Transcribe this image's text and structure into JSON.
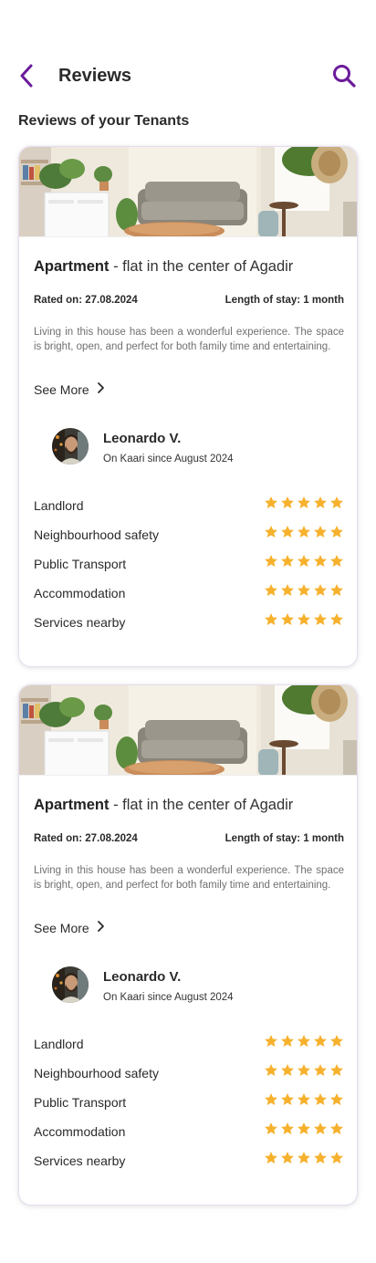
{
  "header": {
    "title": "Reviews"
  },
  "section_title": "Reviews of your Tenants",
  "colors": {
    "accent": "#6a1b9a",
    "star": "#f6b12d"
  },
  "reviews": [
    {
      "title_bold": "Apartment",
      "title_rest": " - flat in the center of Agadir",
      "rated_on": "Rated on: 27.08.2024",
      "length_of_stay": "Length of stay: 1 month",
      "text": "Living in this house has been a wonderful experience. The space is bright, open, and perfect for both family time and entertaining.",
      "see_more": "See More",
      "reviewer": {
        "name": "Leonardo V.",
        "since": "On Kaari since August 2024"
      },
      "ratings": [
        {
          "label": "Landlord",
          "stars": 5
        },
        {
          "label": "Neighbourhood safety",
          "stars": 5
        },
        {
          "label": "Public Transport",
          "stars": 5
        },
        {
          "label": "Accommodation",
          "stars": 5
        },
        {
          "label": "Services nearby",
          "stars": 5
        }
      ]
    },
    {
      "title_bold": "Apartment",
      "title_rest": " - flat in the center of Agadir",
      "rated_on": "Rated on: 27.08.2024",
      "length_of_stay": "Length of stay: 1 month",
      "text": "Living in this house has been a wonderful experience. The space is bright, open, and perfect for both family time and entertaining.",
      "see_more": "See More",
      "reviewer": {
        "name": "Leonardo V.",
        "since": "On Kaari since August 2024"
      },
      "ratings": [
        {
          "label": "Landlord",
          "stars": 5
        },
        {
          "label": "Neighbourhood safety",
          "stars": 5
        },
        {
          "label": "Public Transport",
          "stars": 5
        },
        {
          "label": "Accommodation",
          "stars": 5
        },
        {
          "label": "Services nearby",
          "stars": 5
        }
      ]
    }
  ]
}
